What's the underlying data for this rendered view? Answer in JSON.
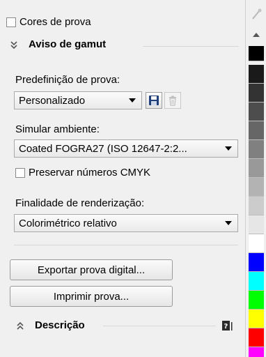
{
  "soft_proof_colors": {
    "label": "Cores de prova",
    "checked": false
  },
  "gamut_section": {
    "title": "Aviso de gamut"
  },
  "proof_preset": {
    "label": "Predefinição de prova:",
    "value": "Personalizado"
  },
  "simulate_environment": {
    "label": "Simular ambiente:",
    "value": "Coated FOGRA27 (ISO 12647-2:2..."
  },
  "preserve_cmyk": {
    "label": "Preservar números CMYK",
    "checked": false
  },
  "rendering_intent": {
    "label": "Finalidade de renderização:",
    "value": "Colorimétrico relativo"
  },
  "buttons": {
    "export": "Exportar prova digital...",
    "print": "Imprimir prova..."
  },
  "description_section": {
    "title": "Descrição"
  },
  "palette": {
    "colors": [
      "#000000",
      "#1a1a1a",
      "#333333",
      "#4d4d4d",
      "#666666",
      "#808080",
      "#999999",
      "#b3b3b3",
      "#cccccc",
      "#e6e6e6",
      "#ffffff",
      "#0000ff",
      "#00ffff",
      "#00ff00",
      "#ffff00",
      "#ff0000",
      "#ff00ff"
    ]
  }
}
